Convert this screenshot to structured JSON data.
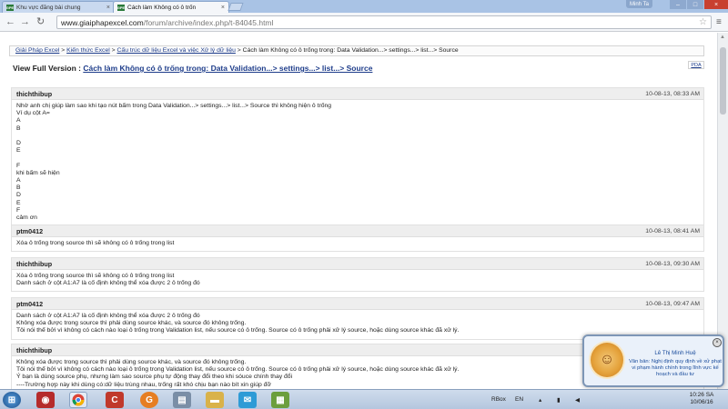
{
  "browser": {
    "tabs": [
      {
        "favicon": "GPE",
        "title": "Khu vực đăng bài chung",
        "active": false
      },
      {
        "favicon": "GPE",
        "title": "Cách làm Không có ô trốn",
        "active": true
      }
    ],
    "user": "Minh Ta",
    "url_domain": "www.giaiphapexcel.com",
    "url_path": "/forum/archive/index.php/t-84045.html"
  },
  "breadcrumb": {
    "items": [
      "Giải Pháp Excel",
      "Kiến thức Excel",
      "Cấu trúc dữ liệu Excel và việc Xử lý dữ liệu"
    ],
    "current": "Cách làm Không có ô trống trong: Data Validation...> settings...> list...> Source",
    "separator": ">"
  },
  "pda": "PDA",
  "full_version": {
    "label": "View Full Version :",
    "link": "Cách làm Không có ô trống trong: Data Validation...> settings...> list...> Source"
  },
  "posts": [
    {
      "user": "thichthibup",
      "date": "10-08-13, 08:33 AM",
      "body": "Nhờ anh chị giúp làm sao khi tạo nút bấm trong Data Validation...> settings...> list...> Source thì không hiện ô trống\nVí dụ cột A=\nA\nB\n\nD\nE\n\nF\nkhi bấm sẽ hiện\nA\nB\nD\nE\nF\ncảm ơn"
    },
    {
      "user": "ptm0412",
      "date": "10-08-13, 08:41 AM",
      "body": "Xóa ô trống trong source thì sẽ không có ô trống trong list"
    },
    {
      "user": "thichthibup",
      "date": "10-08-13, 09:30 AM",
      "body": "Xóa ô trống trong source thì sẽ không có ô trống trong list\nDanh sách ở cột A1:A7 là cố định không thể xóa được 2 ô trống đó"
    },
    {
      "user": "ptm0412",
      "date": "10-08-13, 09:47 AM",
      "body": "Danh sách ở cột A1:A7 là cố định không thể xóa được 2 ô trống đó\nKhông xóa được trong source thì phải dùng source khác, và source đó không trống.\nTôi nói thế bởi vì không có cách nào loại ô trống trong Validation list, nếu source có ô trống. Source có ô trống phải xử lý source, hoặc dùng source khác đã xử lý."
    },
    {
      "user": "thichthibup",
      "date": "",
      "body": "Không xóa được trong source thì phải dùng source khác, và source đó không trống.\nTôi nói thế bởi vì không có cách nào loại ô trống trong Validation list, nếu source có ô trống. Source có ô trống phải xử lý source, hoặc dùng source khác đã xử lý.\nÝ bạn là dùng source phụ, nhưng làm sao source phụ tự động thay đổi theo khi sóuce chính thay đổi\n----Trường hợp này khi dùng có:dữ liệu trùng nhau, trống rất khó chịu bạn nào bít xin giúp đỡ"
    }
  ],
  "notification": {
    "name": "Lê Thị Minh Huệ",
    "message": "Văn bản: Nghị định quy định về xử phạt vi phạm hành chính trong lĩnh vực kế hoạch và đầu tư",
    "close": "×"
  },
  "taskbar": {
    "tray_rbox": "RBox",
    "tray_lang": "EN",
    "time": "10:26 SA",
    "date": "10/06/16"
  }
}
